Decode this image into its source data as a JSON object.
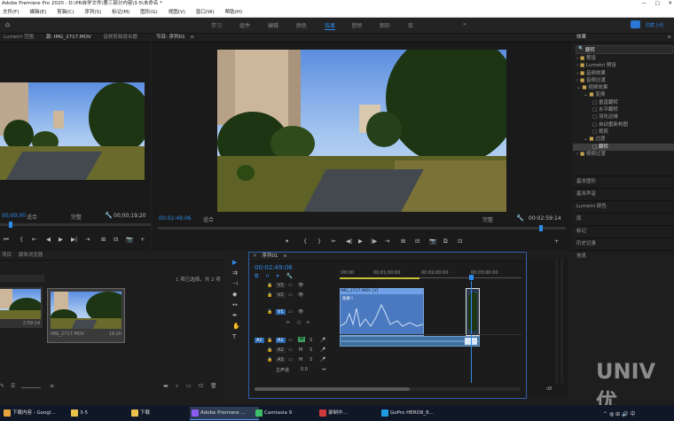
{
  "title": "Adobe Premiere Pro 2020 - D:\\PR自学文件\\第三部分内容\\3-5\\未命名 *",
  "window_controls": {
    "minimize": "—",
    "maximize": "□",
    "close": "✕"
  },
  "menu": [
    "文件(F)",
    "编辑(E)",
    "剪辑(C)",
    "序列(S)",
    "标记(M)",
    "图形(G)",
    "视图(V)",
    "窗口(W)",
    "帮助(H)"
  ],
  "workspaces": [
    "学习",
    "组件",
    "编辑",
    "颜色",
    "效果",
    "音频",
    "图形",
    "库",
    "»"
  ],
  "active_workspace": "效果",
  "top_right_link": "隐藏上线",
  "source_panel": {
    "tabs": [
      "Lumetri 范围",
      "源: IMG_2717.MOV",
      "音频剪辑混合器"
    ],
    "timecode": "00;00;19;20",
    "fit": "适合",
    "quality": "完整"
  },
  "program_panel": {
    "tab": "节目: 序列01",
    "timecode": "00:02:49:06",
    "fit": "适合",
    "quality": "完整",
    "duration": "00:02:59:14"
  },
  "effects_panel": {
    "tab": "效果",
    "search_placeholder": "翻转",
    "tree": [
      "预设",
      "Lumetri 预设",
      "音频效果",
      "音频过渡",
      "视频效果",
      "变换",
      "垂直翻转",
      "水平翻转",
      "羽化边缘",
      "自动重新构图",
      "裁剪",
      "过渡",
      "翻转",
      "视频过渡"
    ],
    "selected": "翻转",
    "sections": [
      "基本图形",
      "基本声音",
      "Lumetri 颜色",
      "库",
      "标记",
      "历史记录",
      "信息"
    ]
  },
  "project_panel": {
    "tabs": [
      "项目",
      "媒体浏览器"
    ],
    "selection_info": "1 项已选择，共 2 项",
    "clips": [
      {
        "name": "IMG_2717.MOV",
        "duration": "2:59:14"
      },
      {
        "name": "IMG_2717.MOV",
        "duration": "19:20"
      }
    ]
  },
  "timeline": {
    "tab": "序列01",
    "timecode": "00:02:49:06",
    "ruler": [
      ":00:00",
      "00:01:00:00",
      "00:02:00:00",
      "00:03:00:00"
    ],
    "video_tracks": [
      "V3",
      "V2",
      "V1"
    ],
    "audio_tracks": [
      "A1",
      "A2",
      "A3"
    ],
    "mix_track": "主声道",
    "mix_value": "0.0",
    "clip_label": "IMG_2717.MOV [V]",
    "clip_sub": "效果 I",
    "track_flags": [
      "M",
      "S"
    ],
    "volume_mark": "—"
  },
  "meter_labels": [
    "dB"
  ],
  "taskbar": [
    {
      "label": "下载内容 - Googl...",
      "color": "#e8a33c"
    },
    {
      "label": "3-5",
      "color": "#e8c04a"
    },
    {
      "label": "下载",
      "color": "#e8c04a"
    },
    {
      "label": "Adobe Premiere ...",
      "color": "#8a5cf0"
    },
    {
      "label": "Camtasia 9",
      "color": "#3cbf6a"
    },
    {
      "label": "录制中...",
      "color": "#d03a3a"
    },
    {
      "label": "GoPro HERO8_8...",
      "color": "#1f9be0"
    }
  ],
  "watermark": "UNIV优"
}
